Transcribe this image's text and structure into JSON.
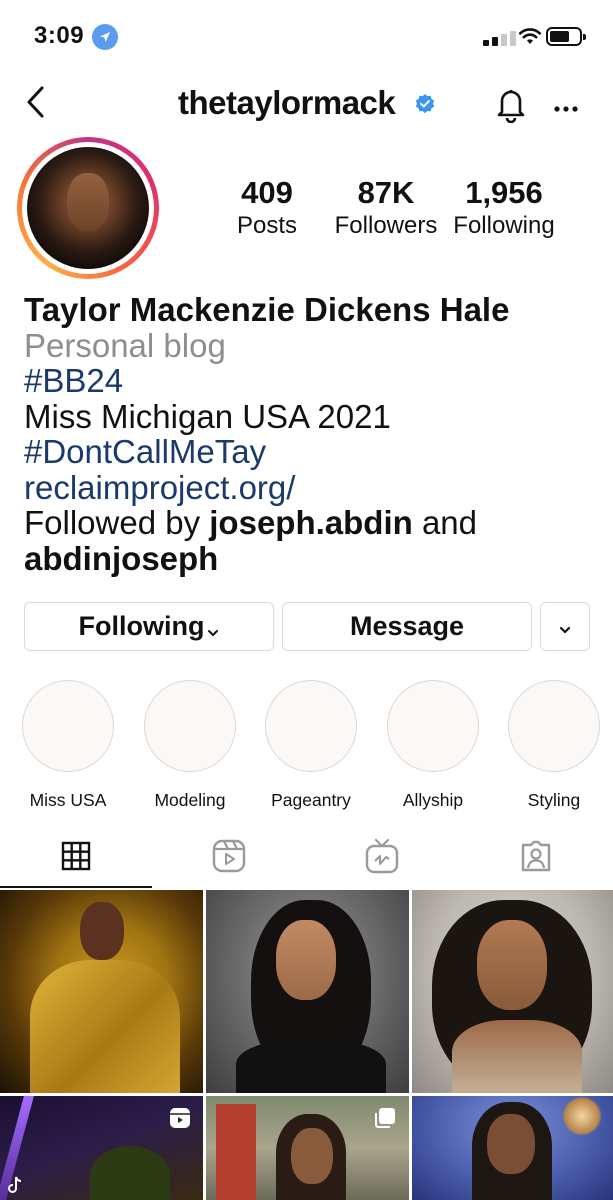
{
  "status": {
    "time": "3:09"
  },
  "header": {
    "username": "thetaylormack"
  },
  "stats": [
    {
      "value": "409",
      "label": "Posts"
    },
    {
      "value": "87K",
      "label": "Followers"
    },
    {
      "value": "1,956",
      "label": "Following"
    }
  ],
  "bio": {
    "name": "Taylor Mackenzie Dickens Hale",
    "category": "Personal blog",
    "line1": "#BB24",
    "line2": "Miss Michigan USA 2021",
    "line3": "#DontCallMeTay",
    "link": "reclaimproject.org/",
    "followed_prefix": "Followed by ",
    "follower1": "joseph.abdin",
    "followed_and": " and",
    "follower2": "abdinjoseph"
  },
  "actions": {
    "following": "Following",
    "message": "Message"
  },
  "highlights": [
    "Miss USA",
    "Modeling",
    "Pageantry",
    "Allyship",
    "Styling"
  ],
  "tabs": [
    "grid-icon",
    "reels-icon",
    "igtv-icon",
    "tagged-icon"
  ],
  "colors": {
    "link": "#1b3a6b",
    "verified": "#3897f0",
    "muted": "#8e8e8e"
  }
}
